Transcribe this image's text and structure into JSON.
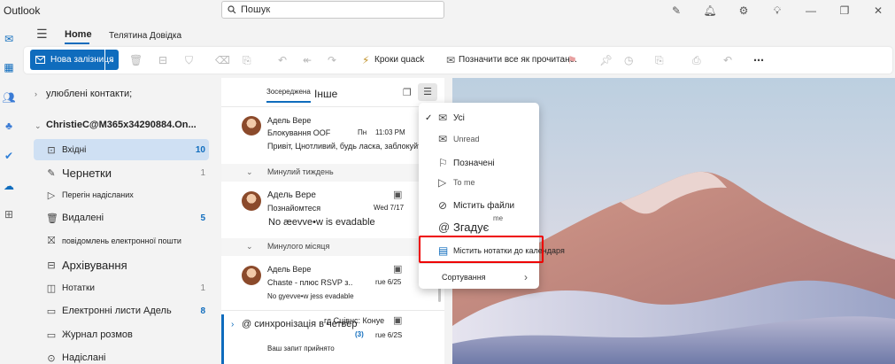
{
  "titlebar": {
    "app_name": "Outlook",
    "search_placeholder": "Пошук",
    "icons": [
      "edit-icon",
      "bell-icon",
      "gear-icon",
      "lightbulb-icon",
      "minimize-icon",
      "restore-icon",
      "close-icon"
    ]
  },
  "rail": {
    "icons": [
      "mail-icon",
      "calendar-icon",
      "people-icon",
      "groups-icon",
      "todo-icon",
      "onedrive-icon",
      "apps-icon"
    ]
  },
  "ribbon": {
    "tab_home": "Home",
    "tab_other": "Телятина Довідка",
    "new_mail_label": "Нова залізниця",
    "quicksteps_label": "Кроки quack",
    "mark_all_read_label": "Позначити все як прочитане.",
    "icons": [
      "delete-icon",
      "archive-icon",
      "report-icon",
      "sweep-icon",
      "move-icon",
      "undo-icon",
      "reply-icon",
      "forward-icon",
      "flag-icon",
      "pin-icon",
      "snooze-icon",
      "rules-icon",
      "print-icon",
      "undo2-icon",
      "more-icon"
    ]
  },
  "folders": {
    "favorites": "улюблені контакти;",
    "account": "ChristieC@M365x34290884.On...",
    "items": [
      {
        "label": "Вхідні",
        "count": "10",
        "icon": "inbox-icon"
      },
      {
        "label": "Чернетки",
        "count": "1",
        "icon": "drafts-icon"
      },
      {
        "label": "Перегін надісланих",
        "count": "",
        "icon": "send-icon"
      },
      {
        "label": "Видалені",
        "count": "5",
        "icon": "trash-icon"
      },
      {
        "label": "повідомлень електронної пошти",
        "count": "",
        "icon": "junk-icon"
      },
      {
        "label": "Архівування",
        "count": "",
        "icon": "archive-icon"
      },
      {
        "label": "Нотатки",
        "count": "1",
        "icon": "notes-icon"
      },
      {
        "label": "Електронні листи Адель",
        "count": "8",
        "icon": "folder-icon"
      },
      {
        "label": "Журнал розмов",
        "count": "",
        "icon": "folder-icon"
      },
      {
        "label": "Надіслані",
        "count": "",
        "icon": "sent-icon"
      }
    ]
  },
  "message_list": {
    "tab_focused": "Зосереджена",
    "tab_other": "Інше",
    "groups": [
      "Минулий тиждень",
      "Минулого місяця"
    ],
    "messages": [
      {
        "sender": "Адель Вере",
        "subject": "Блокування OOF",
        "day": "Пн",
        "time": "11:03 PM",
        "preview": "Привіт, Цнотливий, будь ласка, заблокуйте"
      },
      {
        "sender": "Адель Вере",
        "subject": "Познайомтеся",
        "time": "Wed 7/17",
        "preview": "No æevve•w is evadable"
      },
      {
        "sender": "Адель Вере",
        "subject": "Chaste - плюс RSVP з..",
        "time": "rue 6/25",
        "preview": "No gyevve•w jess evadable"
      },
      {
        "sender": "@ синхронізація в четвер",
        "subject": "гд Сцівнс: Конуе",
        "count": "(3)",
        "time": "rue 6/2S",
        "preview": "Ваш запит прийнято"
      }
    ]
  },
  "filter_menu": {
    "items": [
      {
        "label": "Усі",
        "icon": "mail-icon",
        "checked": true
      },
      {
        "label": "Unread",
        "icon": "unread-icon",
        "checked": false
      },
      {
        "label": "Позначені",
        "icon": "flag-icon",
        "checked": false
      },
      {
        "label": "To me",
        "icon": "send-icon",
        "checked": false
      },
      {
        "label": "Містить файли",
        "icon": "attachment-icon",
        "checked": false
      },
      {
        "label": "Згадує",
        "suffix": "me",
        "icon": "mention-icon",
        "checked": false
      },
      {
        "label": "Містить нотатки до календаря",
        "icon": "calendar-icon",
        "checked": false,
        "highlighted": true
      },
      {
        "label": "Сортування",
        "icon": "",
        "submenu": true
      }
    ]
  },
  "colors": {
    "accent": "#0f6cbd",
    "highlight_border": "#e00000",
    "selected_folder_bg": "#cfe0f3"
  }
}
